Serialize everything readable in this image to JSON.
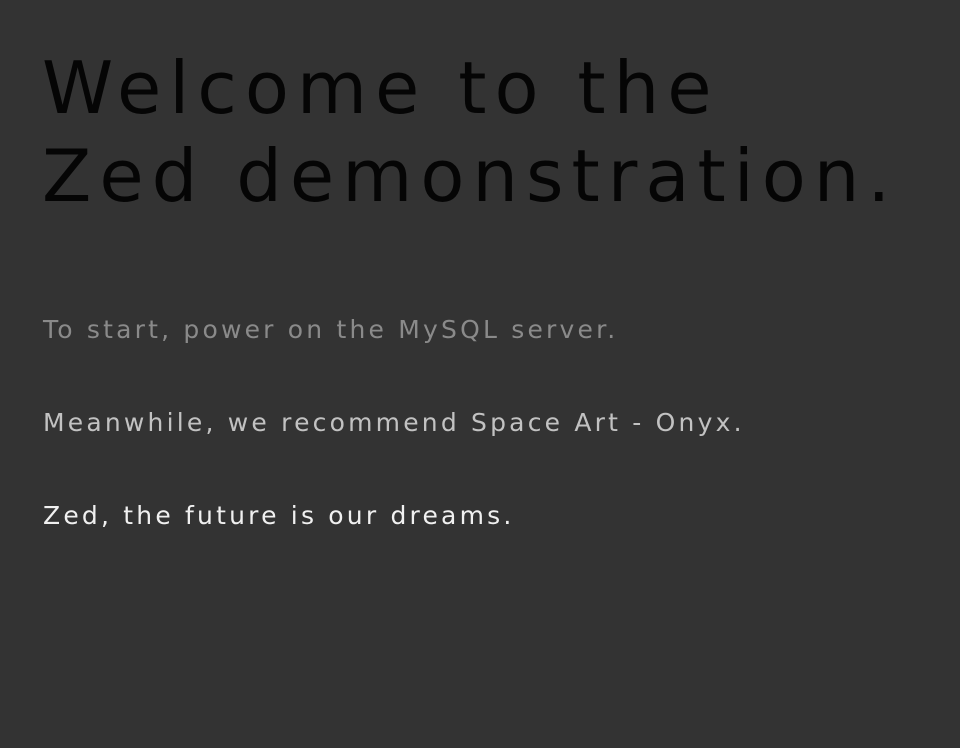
{
  "heading": {
    "line1": "Welcome to the",
    "line2": "Zed demonstration."
  },
  "messages": [
    {
      "text": "To start, power on the MySQL server.",
      "color": "#8a8a8a"
    },
    {
      "text": "Meanwhile, we recommend Space Art - Onyx.",
      "color": "#c2c2c2"
    },
    {
      "text": "Zed, the future is our dreams.",
      "color": "#f0f0f0"
    }
  ],
  "colors": {
    "background": "#333333",
    "heading": "#050505"
  }
}
